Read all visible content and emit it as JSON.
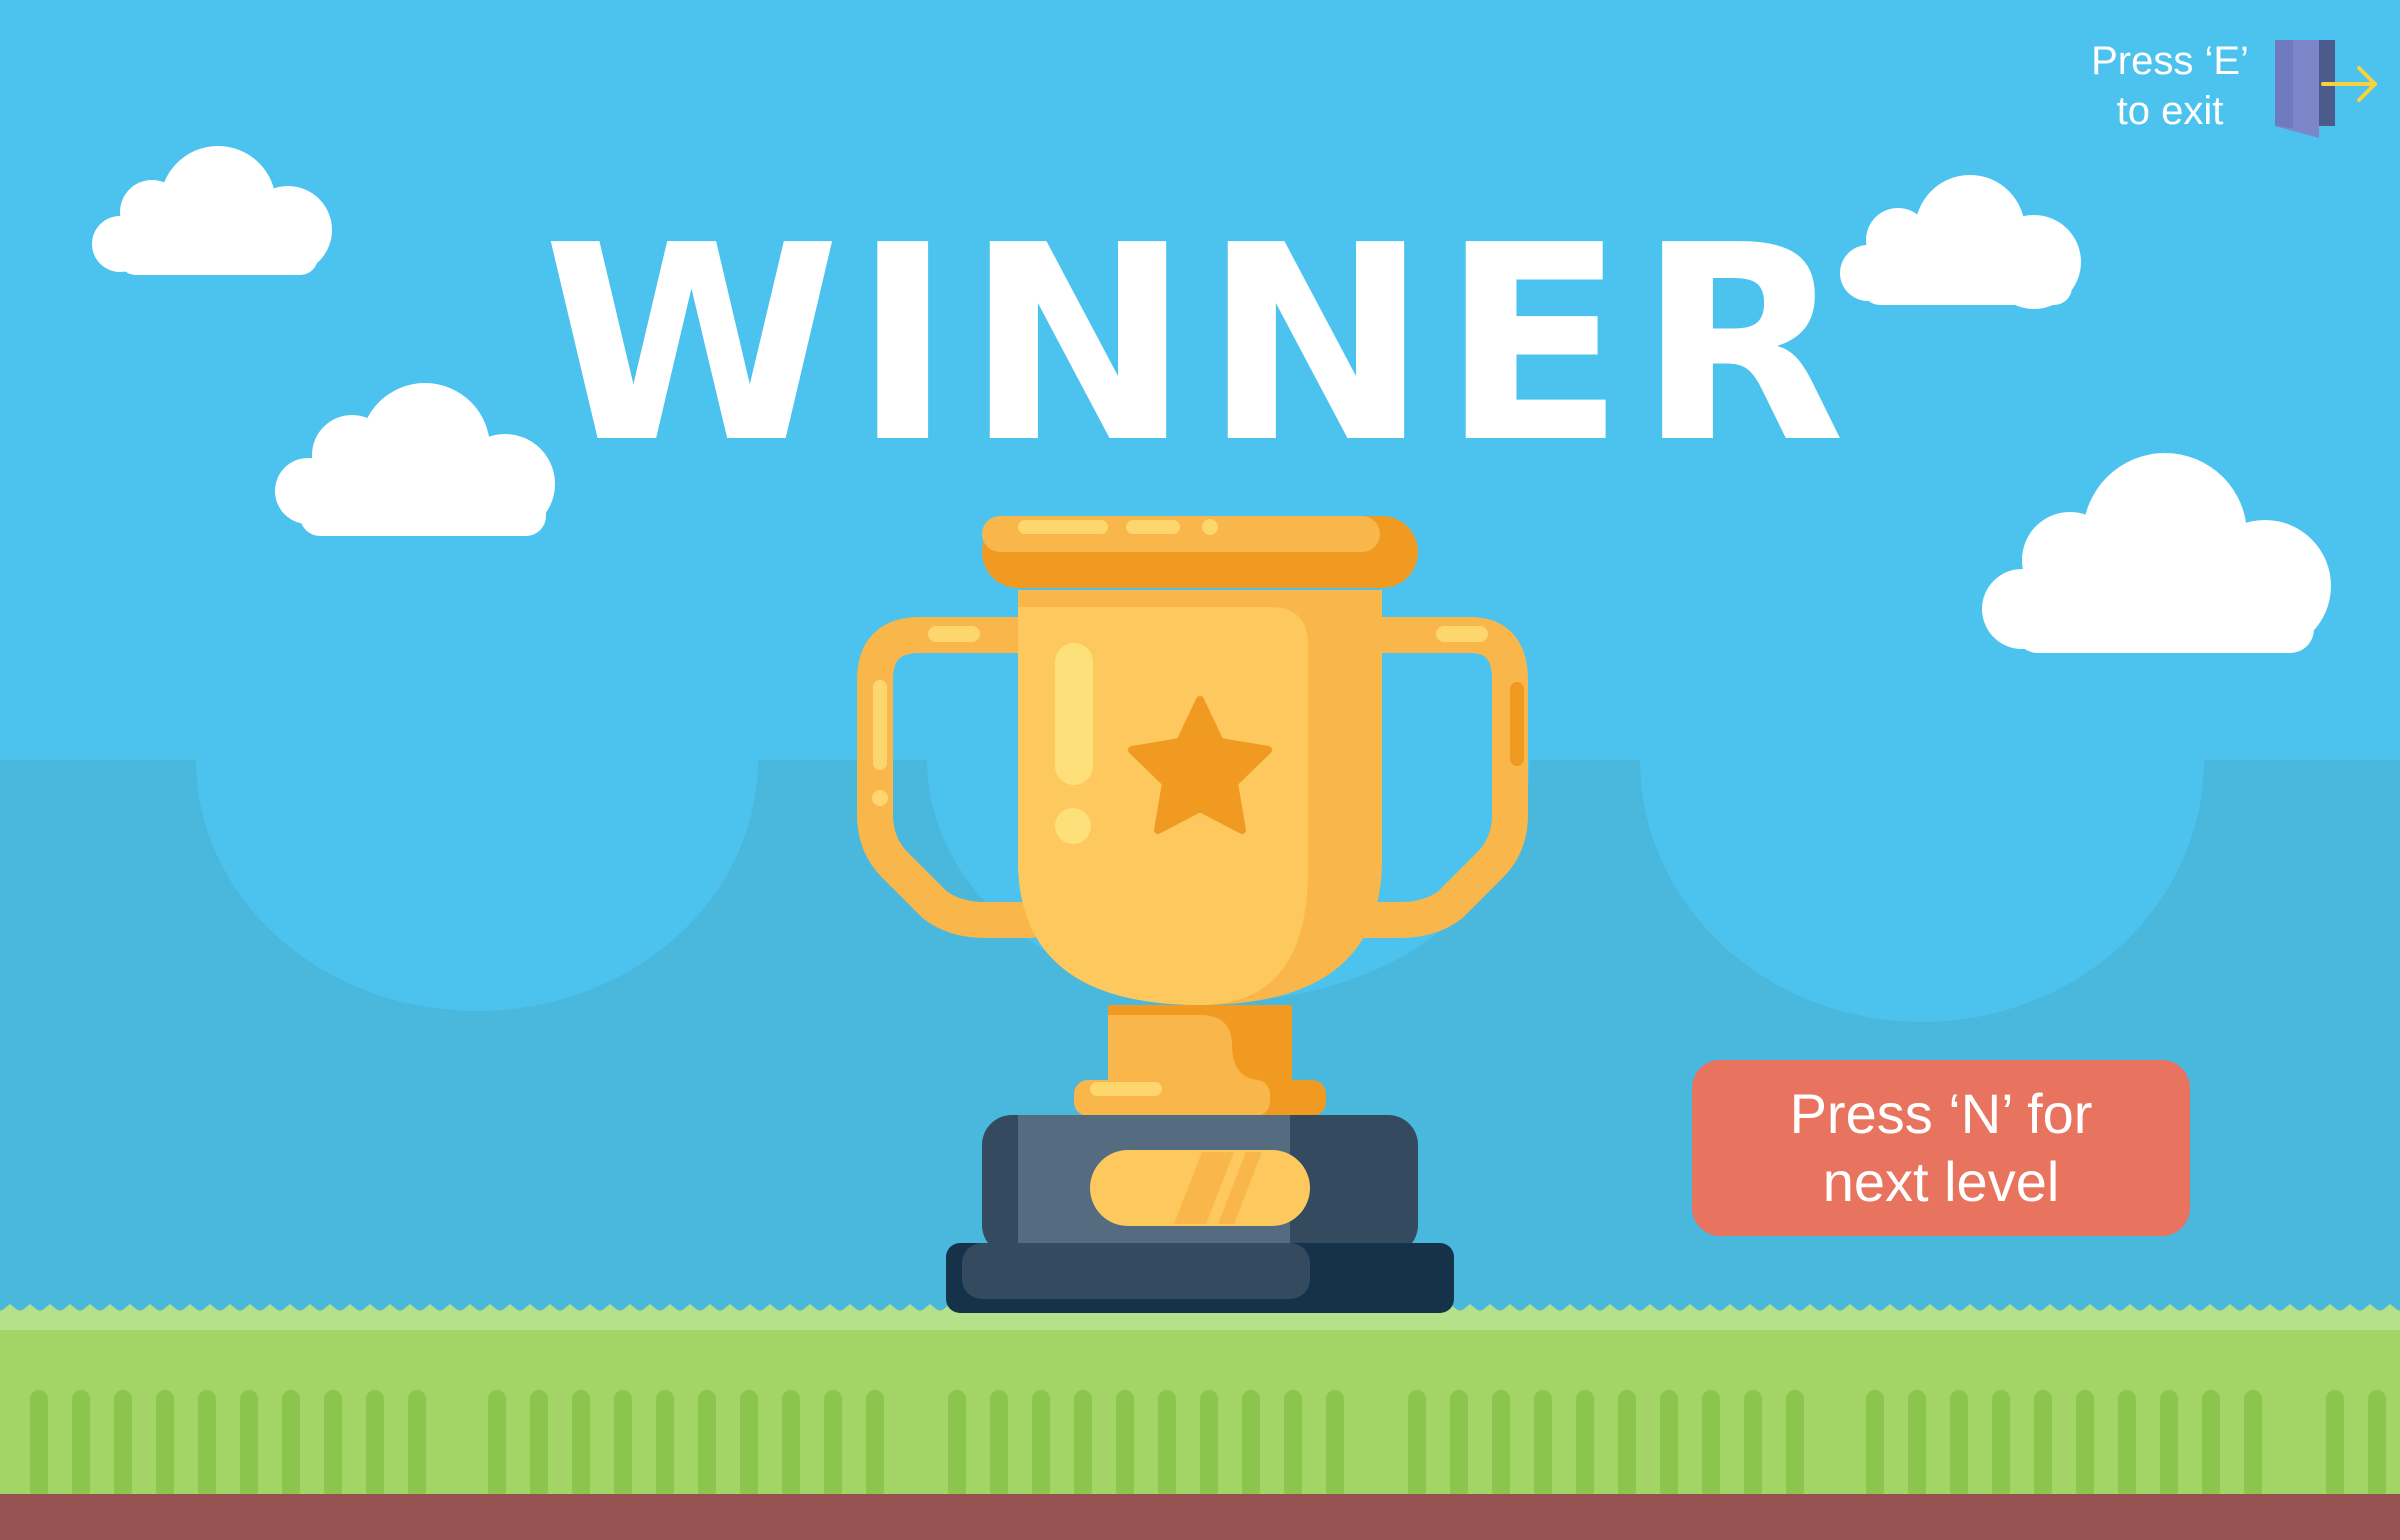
{
  "title": "WINNER",
  "exit_hint": {
    "line1": "Press ‘E’",
    "line2": "to exit",
    "icon": "exit-door-icon"
  },
  "next_level_button": {
    "line1": "Press ‘N’ for",
    "line2": "next level"
  },
  "trophy": {
    "icon": "trophy-icon",
    "emblem": "star-icon"
  },
  "colors": {
    "sky": "#4CC3EE",
    "hills": "#4AB7DD",
    "grass": "#A2D566",
    "grass_top": "#B6E08A",
    "grass_stripes": "#8CC54E",
    "soil": "#965251",
    "button": "#E8745F",
    "trophy_gold": "#F9B64A",
    "trophy_orange": "#F09A22",
    "base_dark": "#33475E"
  }
}
